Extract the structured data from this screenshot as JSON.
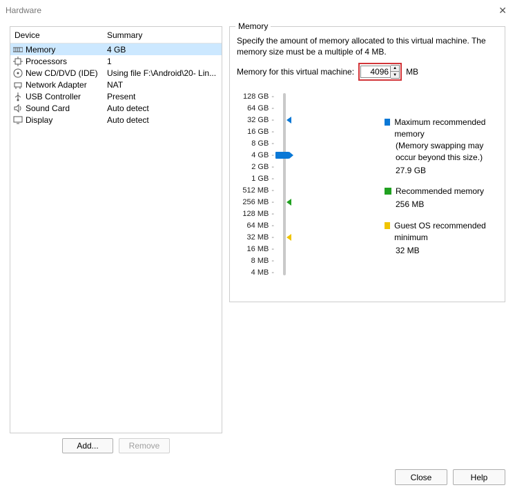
{
  "window": {
    "title": "Hardware"
  },
  "table": {
    "headers": {
      "device": "Device",
      "summary": "Summary"
    },
    "rows": [
      {
        "icon": "memory",
        "name": "Memory",
        "summary": "4 GB",
        "selected": true
      },
      {
        "icon": "cpu",
        "name": "Processors",
        "summary": "1"
      },
      {
        "icon": "disc",
        "name": "New CD/DVD (IDE)",
        "summary": "Using file F:\\Android\\20- Lin..."
      },
      {
        "icon": "net",
        "name": "Network Adapter",
        "summary": "NAT"
      },
      {
        "icon": "usb",
        "name": "USB Controller",
        "summary": "Present"
      },
      {
        "icon": "sound",
        "name": "Sound Card",
        "summary": "Auto detect"
      },
      {
        "icon": "display",
        "name": "Display",
        "summary": "Auto detect"
      }
    ]
  },
  "buttons": {
    "add": "Add...",
    "remove": "Remove",
    "close": "Close",
    "help": "Help"
  },
  "memory": {
    "group": "Memory",
    "description": "Specify the amount of memory allocated to this virtual machine. The memory size must be a multiple of 4 MB.",
    "input_label": "Memory for this virtual machine:",
    "value": "4096",
    "unit": "MB",
    "ticks": [
      "128 GB",
      "64 GB",
      "32 GB",
      "16 GB",
      "8 GB",
      "4 GB",
      "2 GB",
      "1 GB",
      "512 MB",
      "256 MB",
      "128 MB",
      "64 MB",
      "32 MB",
      "16 MB",
      "8 MB",
      "4 MB"
    ],
    "thumb_tick_index": 5,
    "markers": {
      "blue_index": 2,
      "green_index": 9,
      "yellow_index": 12
    },
    "legend": {
      "max": {
        "label": "Maximum recommended memory",
        "sub": "(Memory swapping may occur beyond this size.)",
        "value": "27.9 GB"
      },
      "rec": {
        "label": "Recommended memory",
        "value": "256 MB"
      },
      "min": {
        "label": "Guest OS recommended minimum",
        "value": "32 MB"
      }
    }
  }
}
